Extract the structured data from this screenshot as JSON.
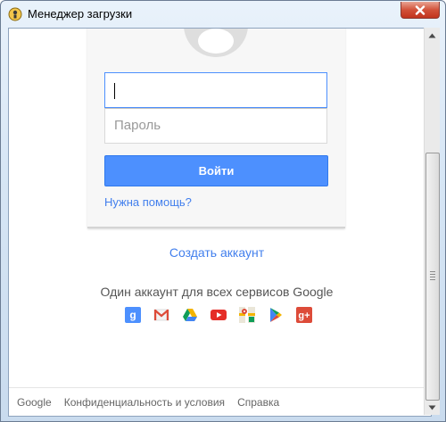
{
  "window": {
    "title": "Менеджер загрузки"
  },
  "form": {
    "password_placeholder": "Пароль",
    "signin_label": "Войти",
    "help_link": "Нужна помощь?"
  },
  "create_account": "Создать аккаунт",
  "tagline": "Один аккаунт для всех сервисов Google",
  "services": [
    {
      "name": "google-search",
      "color": "#4d90fe"
    },
    {
      "name": "gmail",
      "color": "#dd4b39"
    },
    {
      "name": "drive",
      "color": "#0f9d58"
    },
    {
      "name": "youtube",
      "color": "#e52d27"
    },
    {
      "name": "maps",
      "color": "#f4b400"
    },
    {
      "name": "play",
      "color": "#4285f4"
    },
    {
      "name": "google-plus",
      "color": "#dd4b39"
    }
  ],
  "footer": {
    "google": "Google",
    "privacy": "Конфиденциальность и условия",
    "help": "Справка"
  }
}
